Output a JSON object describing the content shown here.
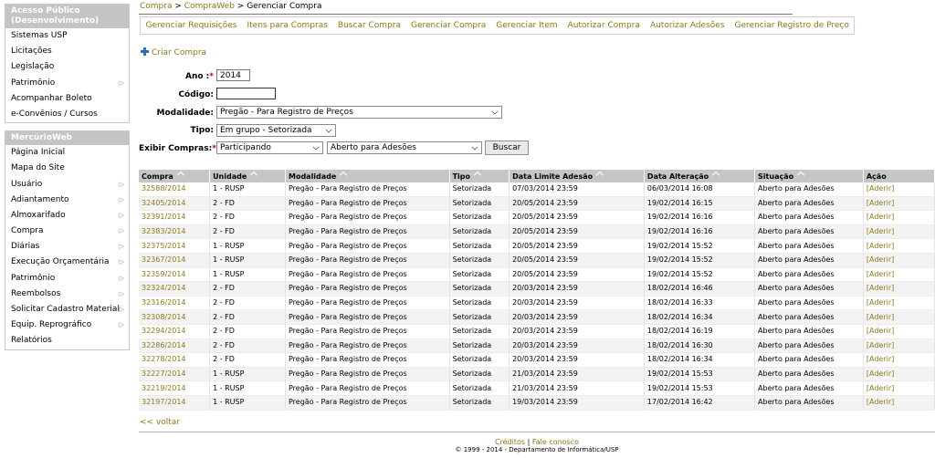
{
  "sidebar": {
    "public_box": {
      "header": "Acesso Público (Desenvolvimento)",
      "items": [
        {
          "label": "Sistemas USP",
          "arrow": false
        },
        {
          "label": "Licitações",
          "arrow": false
        },
        {
          "label": "Legislação",
          "arrow": false
        },
        {
          "label": "Patrimônio",
          "arrow": true
        },
        {
          "label": "Acompanhar Boleto",
          "arrow": false
        },
        {
          "label": "e-Convênios / Cursos",
          "arrow": false
        }
      ]
    },
    "mercurio_box": {
      "header": "MercúrioWeb",
      "items": [
        {
          "label": "Página Inicial",
          "arrow": false
        },
        {
          "label": "Mapa do Site",
          "arrow": false
        },
        {
          "label": "Usuário",
          "arrow": true
        },
        {
          "label": "Adiantamento",
          "arrow": true
        },
        {
          "label": "Almoxarifado",
          "arrow": true
        },
        {
          "label": "Compra",
          "arrow": true
        },
        {
          "label": "Diárias",
          "arrow": true
        },
        {
          "label": "Execução Orçamentária",
          "arrow": true
        },
        {
          "label": "Patrimônio",
          "arrow": true
        },
        {
          "label": "Reembolsos",
          "arrow": true
        },
        {
          "label": "Solicitar Cadastro Material",
          "arrow": true
        },
        {
          "label": "Equip. Reprográfico",
          "arrow": true
        },
        {
          "label": "Relatórios",
          "arrow": false
        }
      ]
    }
  },
  "breadcrumb": {
    "part1": "Compra",
    "sep": ">",
    "part2": "CompraWeb",
    "current": "Gerenciar Compra"
  },
  "tabs": [
    "Gerenciar Requisições",
    "Itens para Compras",
    "Buscar Compra",
    "Gerenciar Compra",
    "Gerenciar Item",
    "Autorizar Compra",
    "Autorizar Adesões",
    "Gerenciar Registro de Preço"
  ],
  "criar_compra": "Criar Compra",
  "form": {
    "ano_label": "Ano :",
    "ano_value": "2014",
    "codigo_label": "Código:",
    "codigo_value": "",
    "modalidade_label": "Modalidade:",
    "modalidade_value": "Pregão - Para Registro de Preços",
    "tipo_label": "Tipo:",
    "tipo_value": "Em grupo - Setorizada",
    "exibir_label": "Exibir Compras:",
    "exibir_value1": "Participando",
    "exibir_value2": "Aberto para Adesões",
    "required_mark": "*",
    "buscar": "Buscar"
  },
  "table": {
    "headers": [
      "Compra",
      "Unidade",
      "Modalidade",
      "Tipo",
      "Data Limite Adesão",
      "Data Alteração",
      "Situação",
      "Ação"
    ],
    "rows": [
      [
        "32588/2014",
        "1 - RUSP",
        "Pregão - Para Registro de Preços",
        "Setorizada",
        "07/03/2014 23:59",
        "06/03/2014 16:08",
        "Aberto para Adesões",
        "[Aderir]"
      ],
      [
        "32405/2014",
        "2 - FD",
        "Pregão - Para Registro de Preços",
        "Setorizada",
        "20/05/2014 23:59",
        "19/02/2014 16:15",
        "Aberto para Adesões",
        "[Aderir]"
      ],
      [
        "32391/2014",
        "2 - FD",
        "Pregão - Para Registro de Preços",
        "Setorizada",
        "20/05/2014 23:59",
        "19/02/2014 16:16",
        "Aberto para Adesões",
        "[Aderir]"
      ],
      [
        "32383/2014",
        "2 - FD",
        "Pregão - Para Registro de Preços",
        "Setorizada",
        "20/05/2014 23:59",
        "19/02/2014 16:16",
        "Aberto para Adesões",
        "[Aderir]"
      ],
      [
        "32375/2014",
        "1 - RUSP",
        "Pregão - Para Registro de Preços",
        "Setorizada",
        "20/05/2014 23:59",
        "19/02/2014 15:52",
        "Aberto para Adesões",
        "[Aderir]"
      ],
      [
        "32367/2014",
        "1 - RUSP",
        "Pregão - Para Registro de Preços",
        "Setorizada",
        "20/05/2014 23:59",
        "19/02/2014 15:52",
        "Aberto para Adesões",
        "[Aderir]"
      ],
      [
        "32359/2014",
        "1 - RUSP",
        "Pregão - Para Registro de Preços",
        "Setorizada",
        "20/05/2014 23:59",
        "19/02/2014 15:52",
        "Aberto para Adesões",
        "[Aderir]"
      ],
      [
        "32324/2014",
        "2 - FD",
        "Pregão - Para Registro de Preços",
        "Setorizada",
        "20/03/2014 23:59",
        "18/02/2014 16:46",
        "Aberto para Adesões",
        "[Aderir]"
      ],
      [
        "32316/2014",
        "2 - FD",
        "Pregão - Para Registro de Preços",
        "Setorizada",
        "20/03/2014 23:59",
        "18/02/2014 16:33",
        "Aberto para Adesões",
        "[Aderir]"
      ],
      [
        "32308/2014",
        "2 - FD",
        "Pregão - Para Registro de Preços",
        "Setorizada",
        "20/03/2014 23:59",
        "18/02/2014 16:34",
        "Aberto para Adesões",
        "[Aderir]"
      ],
      [
        "32294/2014",
        "2 - FD",
        "Pregão - Para Registro de Preços",
        "Setorizada",
        "20/03/2014 23:59",
        "18/02/2014 16:19",
        "Aberto para Adesões",
        "[Aderir]"
      ],
      [
        "32286/2014",
        "2 - FD",
        "Pregão - Para Registro de Preços",
        "Setorizada",
        "20/03/2014 23:59",
        "18/02/2014 16:30",
        "Aberto para Adesões",
        "[Aderir]"
      ],
      [
        "32278/2014",
        "2 - FD",
        "Pregão - Para Registro de Preços",
        "Setorizada",
        "20/03/2014 23:59",
        "18/02/2014 16:34",
        "Aberto para Adesões",
        "[Aderir]"
      ],
      [
        "32227/2014",
        "1 - RUSP",
        "Pregão - Para Registro de Preços",
        "Setorizada",
        "21/03/2014 23:59",
        "19/02/2014 15:53",
        "Aberto para Adesões",
        "[Aderir]"
      ],
      [
        "32219/2014",
        "1 - RUSP",
        "Pregão - Para Registro de Preços",
        "Setorizada",
        "21/03/2014 23:59",
        "19/02/2014 15:53",
        "Aberto para Adesões",
        "[Aderir]"
      ],
      [
        "32197/2014",
        "1 - RUSP",
        "Pregão - Para Registro de Preços",
        "Setorizada",
        "19/03/2014 23:59",
        "17/02/2014 16:42",
        "Aberto para Adesões",
        "[Aderir]"
      ]
    ]
  },
  "voltar": "<<  voltar",
  "footer": {
    "creditos": "Créditos",
    "sep": "|",
    "fale": "Fale conosco",
    "copyright": "© 1999 - 2014 - Departamento de Informática/USP"
  },
  "colors": {
    "link": "#8a7a17",
    "header_bg": "#c6c6c6",
    "required": "#cc0000",
    "plus_icon": "#2b6fb6"
  }
}
